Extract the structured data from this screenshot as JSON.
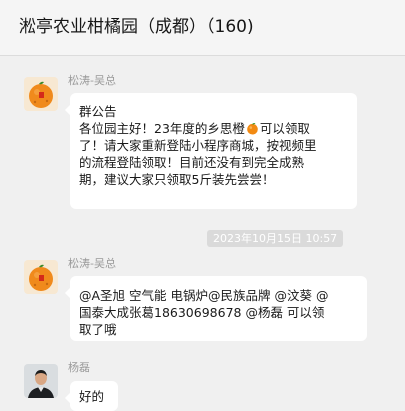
{
  "chat": {
    "title": "淞亭农业柑橘园（成都）（160)"
  },
  "messages": [
    {
      "sender": "松涛-吴总",
      "lines": [
        "群公告",
        "各位园主好！23年度的乡思橙",
        "可以领取",
        "了！请大家重新登陆小程序商城，按视频里",
        "的流程登陆领取！目前还没有到完全成熟",
        "期，建议大家只领取5斤装先尝尝！"
      ],
      "emoji": "orange-emoji"
    },
    {
      "timestamp": "2023年10月15日 10:57"
    },
    {
      "sender": "松涛-吴总",
      "lines": [
        "@A圣旭 空气能 电锅炉@民族品牌 @汶葵 @",
        "国泰大成张葛18630698678 @杨磊 可以领",
        "取了哦"
      ]
    },
    {
      "sender": "杨磊",
      "lines": [
        "好的"
      ]
    }
  ],
  "colors": {
    "background": "#f0f0f0",
    "bubble": "#ffffff",
    "timestamp_bg": "#dadada",
    "sender": "#9a9a9a"
  }
}
